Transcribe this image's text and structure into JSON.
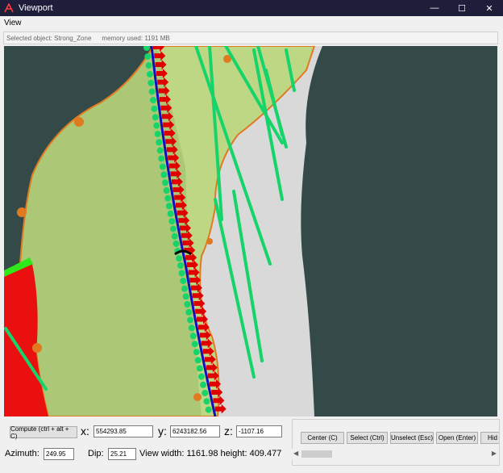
{
  "window": {
    "title": "Viewport",
    "minimize_icon": "minimize-icon",
    "maximize_icon": "maximize-icon",
    "close_icon": "close-icon"
  },
  "menu": {
    "items": [
      "View"
    ]
  },
  "status": {
    "selected_object": "Selected object: Strong_Zone",
    "memory": "memory used: 1191 MB"
  },
  "controls": {
    "compute_label": "Compute (ctrl + alt + C)",
    "x_label": "x:",
    "x_value": "554293.85",
    "y_label": "y:",
    "y_value": "6243182.56",
    "z_label": "z:",
    "z_value": "-1107.16",
    "azimuth_label": "Azimuth:",
    "azimuth_value": "249.95",
    "dip_label": "Dip:",
    "dip_value": "25.21",
    "view_info": "View width: 1161.98 height: 409.477"
  },
  "actions": {
    "center_label": "Center (C)",
    "select_label": "Select (Ctrl)",
    "unselect_label": "Unselect (Esc)",
    "open_label": "Open (Enter)",
    "hide_label": "Hid"
  },
  "colors": {
    "background": "#334a49",
    "zone_fill": "#b8d77a",
    "surface": "#d8d8d8",
    "well_green": "#17d46a",
    "arrow_red": "#e00000",
    "arrow_blue": "#1010c0",
    "node_orange": "#e07a20"
  }
}
